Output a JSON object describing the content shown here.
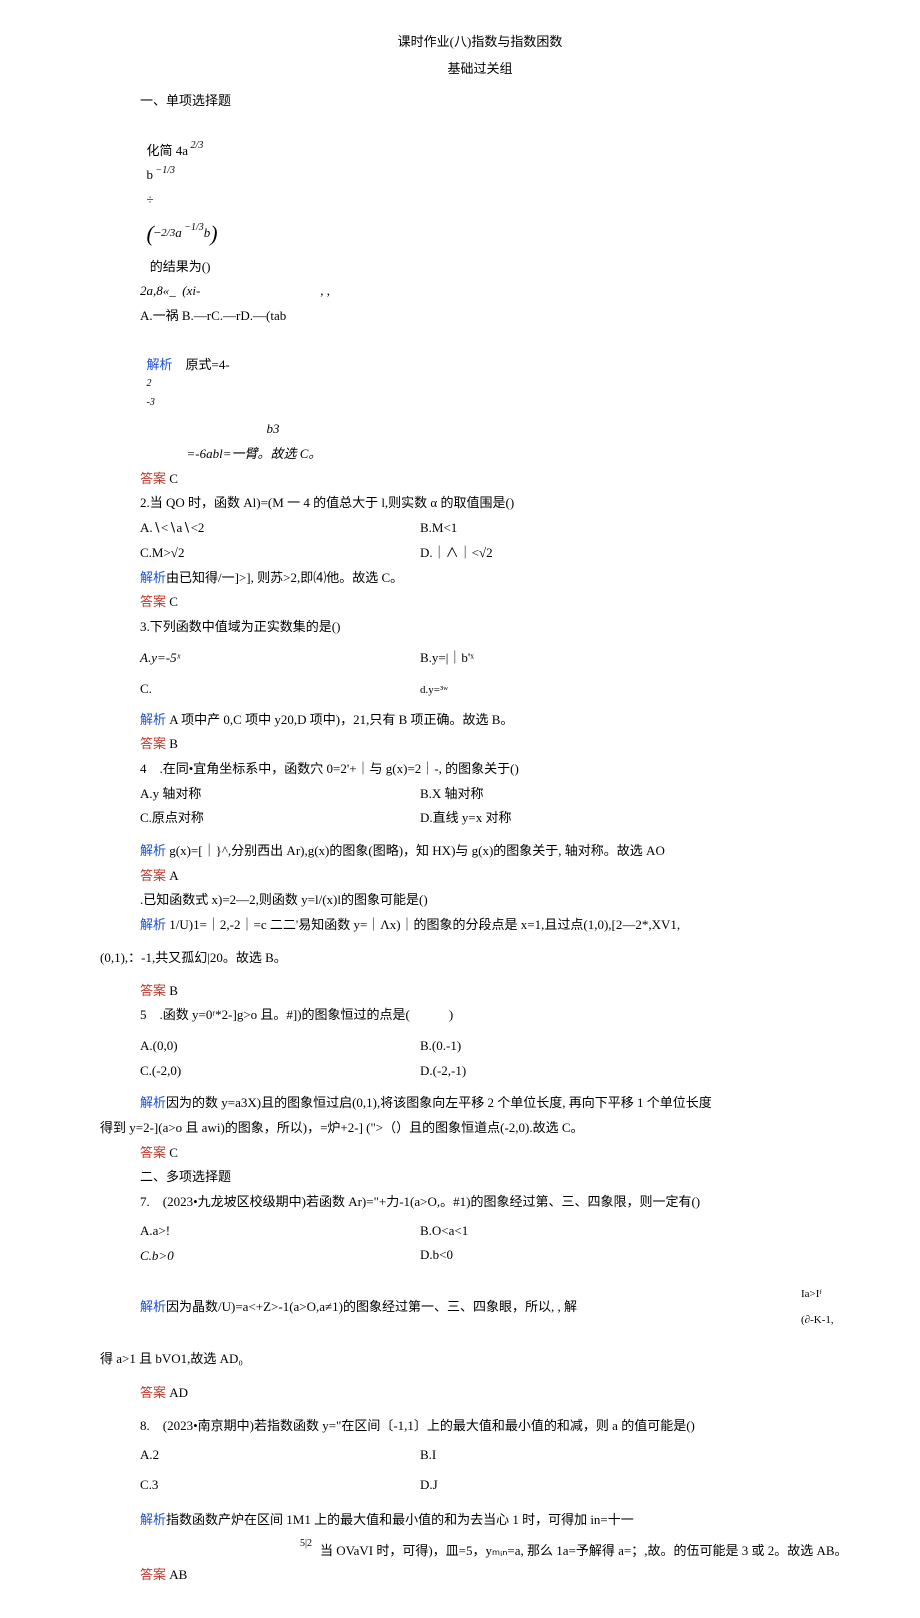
{
  "title": "课时作业(八)指数与指数困数",
  "subtitle": "基础过关组",
  "sec1_heading": "一、单项选择题",
  "q1": {
    "stem_prefix": "化简 4a",
    "stem_mid": "b",
    "stem_tail": "的结果为()",
    "frac_top1": "2",
    "frac_bot1": "3",
    "frac_top2": "1",
    "frac_bot2": "3",
    "frac_mid": "÷",
    "inner": "−",
    "inner_frac_top": "2",
    "inner_frac_bot": "3",
    "inner_a": "a",
    "inner_b": "b",
    "line2_a": "2a,8«_  (xi-",
    "line2_b": ", ,",
    "choices": "A.一祸 B.—rC.—rD.—(tab",
    "jiexi_label": "解析",
    "jiexi_text": "原式=4-",
    "jiexi_mid_sup": "2",
    "jiexi_mid_sub": "-3",
    "jiexi_b3": "b3",
    "jiexi_tail": "=-6abl=一臂。故选 C。",
    "ans_label": "答案",
    "ans": "C"
  },
  "q2": {
    "stem": "2.当 QO 时，函数 Al)=(M 一 4 的值总大于 l,则实数 α 的取值围是()",
    "a": "A.∖<∖a∖<2",
    "b": "B.M<1",
    "c": "C.M>√2",
    "d": "D.｜∧｜<√2",
    "jiexi_label": "解析",
    "jiexi": "由已知得/一]>], 则苏>2,即⑷他。故选 C。",
    "ans_label": "答案",
    "ans": "C"
  },
  "q3": {
    "stem": "3.下列函数中值域为正实数集的是()",
    "a": "A.y=-5ˣ",
    "b": "B.y=|｜b'ˣ",
    "c": "C.",
    "d": "d.y=³ʷ",
    "jiexi_label": "解析",
    "jiexi": "A 项中产 0,C 项中 y20,D 项中)，21,只有 B 项正确。故选 B。",
    "ans_label": "答案",
    "ans": "B"
  },
  "q4": {
    "stem": "4　.在同•宜角坐标系中，函数穴 0=2'+｜与 g(x)=2｜-, 的图象关于()",
    "a": "A.y 轴对称",
    "b": "B.X 轴对称",
    "c": "C.原点对称",
    "d": "D.直线 y=x 对称",
    "jiexi_label": "解析",
    "jiexi": "g(x)=[｜}^,分别西出 Ar),g(x)的图象(图略)，知 HX)与 g(x)的图象关于, 轴对称。故选 AO",
    "ans_label": "答案",
    "ans": "A"
  },
  "q45": {
    "stem": ".已知函数式 x)=2—2,则函数 y=l/(x)l的图象可能是()",
    "jiexi_label": "解析",
    "jiexi": "1/U)1=｜2,-2｜=c 二二'易知函数 y=｜Λx)｜的图象的分段点是 x=1,且过点(1,0),[2—2*,XV1,",
    "jiexi2": "(0,1),：-1,共又孤幻|20。故选 B。",
    "ans_label": "答案",
    "ans": "B"
  },
  "q5": {
    "stem": "5　.函数 y=0ʳ*2-]g>o 且。#])的图象恒过的点是(　　　)",
    "a": "A.(0,0)",
    "b": "B.(0.-1)",
    "c": "C.(-2,0)",
    "d": "D.(-2,-1)",
    "jiexi_label": "解析",
    "jiexi": "因为的数 y=a3X)且的图象恒过启(0,1),将该图象向左平移 2 个单位长度, 再向下平移 1 个单位长度",
    "jiexi2": "得到 y=2-](a>o 且 awi)的图象，所以)，=炉+2-] (\">（）且的图象恒道点(-2,0).故选 C。",
    "ans_label": "答案",
    "ans": "C"
  },
  "sec2_heading": "二、多项选择题",
  "q7": {
    "stem": "7.　(2023•九龙坡区校级期中)若函数 Ar)=\"+力-1(a>O,。#1)的图象经过第、三、四象限，则一定有()",
    "a": "A.a>!",
    "b": "B.O<a<1",
    "c": "C.b>0",
    "d": "D.b<0",
    "jiexi_label": "解析",
    "jiexi": "因为晶数/U)=a<+Z>-1(a>O,a≠1)的图象经过第一、三、四象眼，所以, , 解",
    "jiexi_side1": "Ia>Iᶠ",
    "jiexi_side2": "(∂-K-1,",
    "jiexi2": "得 a>1 且 bVO1,故选 AD₀",
    "ans_label": "答案",
    "ans": "AD"
  },
  "q8": {
    "stem": "8.　(2023•南京期中)若指数函数 y=\"在区间〔-1,1〕上的最大值和最小值的和减，则 a 的值可能是()",
    "a": "A.2",
    "b": "B.I",
    "c": "C.3",
    "d": "D.J",
    "jiexi_label": "解析",
    "jiexi": "指数函数产炉在区间 1M1 上的最大值和最小值的和为去当心 1 时，可得加 in=十一",
    "jiexi_frac": "5|2",
    "jiexi2": "当 OVaVI 时，可得)，皿=5，yₘᵢₙ=a, 那么 1a=予解得 a=；,故。的伍可能是 3 或 2。故选 AB。",
    "ans_label": "答案",
    "ans": "AB"
  }
}
